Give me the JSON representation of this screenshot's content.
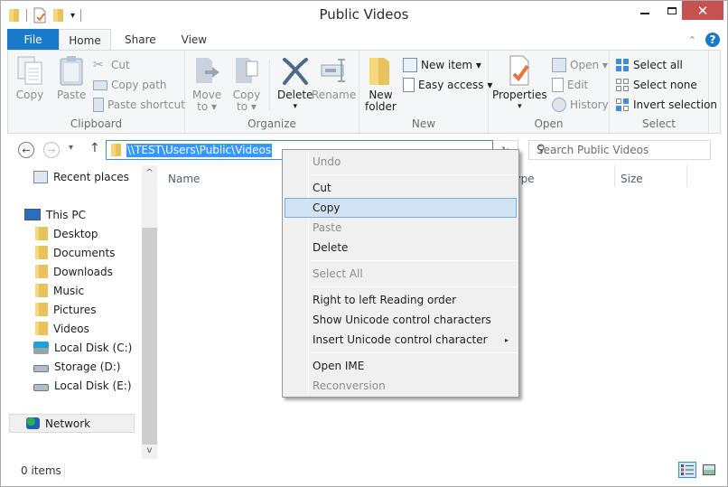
{
  "window": {
    "title": "Public Videos",
    "controls": {
      "minimize": "—",
      "maximize": "☐",
      "close": "✕"
    }
  },
  "quick_access": {
    "dropdown": "▾"
  },
  "ribbon_tabs": [
    {
      "label": "File"
    },
    {
      "label": "Home"
    },
    {
      "label": "Share"
    },
    {
      "label": "View"
    }
  ],
  "ribbon": {
    "clipboard": {
      "label": "Clipboard",
      "copy": "Copy",
      "paste": "Paste",
      "cut": "Cut",
      "copy_path": "Copy path",
      "paste_shortcut": "Paste shortcut"
    },
    "organize": {
      "label": "Organize",
      "move_to": "Move",
      "move_to_2": "to ▾",
      "copy_to": "Copy",
      "copy_to_2": "to ▾",
      "delete": "Delete",
      "delete_arrow": "▾",
      "rename": "Rename"
    },
    "new": {
      "label": "New",
      "new_folder": "New",
      "new_folder_2": "folder",
      "new_item": "New item ▾",
      "easy_access": "Easy access ▾"
    },
    "open": {
      "label": "Open",
      "properties": "Properties",
      "properties_arrow": "▾",
      "open": "Open ▾",
      "edit": "Edit",
      "history": "History"
    },
    "select": {
      "label": "Select",
      "select_all": "Select all",
      "select_none": "Select none",
      "invert_selection": "Invert selection"
    }
  },
  "navigation": {
    "back": "←",
    "forward": "→",
    "recent": "▾",
    "up": "↑",
    "address": "\\\\TEST\\Users\\Public\\Videos",
    "refresh": "↻",
    "search_placeholder": "Search Public Videos",
    "search_icon": "⚲"
  },
  "nav_pane": {
    "items": [
      {
        "label": "Recent places",
        "icon": "recent-places-icon"
      },
      {
        "label": "This PC",
        "icon": "computer-icon"
      },
      {
        "label": "Desktop",
        "icon": "desktop-folder-icon"
      },
      {
        "label": "Documents",
        "icon": "documents-folder-icon"
      },
      {
        "label": "Downloads",
        "icon": "downloads-folder-icon"
      },
      {
        "label": "Music",
        "icon": "music-folder-icon"
      },
      {
        "label": "Pictures",
        "icon": "pictures-folder-icon"
      },
      {
        "label": "Videos",
        "icon": "videos-folder-icon"
      },
      {
        "label": "Local Disk (C:)",
        "icon": "system-drive-icon"
      },
      {
        "label": "Storage (D:)",
        "icon": "drive-icon"
      },
      {
        "label": "Local Disk (E:)",
        "icon": "drive-icon"
      },
      {
        "label": "Network",
        "icon": "network-icon"
      }
    ],
    "scroll_up": "^",
    "scroll_down": "v"
  },
  "columns": [
    "Name",
    "Type",
    "Size"
  ],
  "status": {
    "items": "0 items"
  },
  "context_menu": {
    "items": [
      {
        "label": "Undo",
        "enabled": false
      },
      {
        "label": "Cut",
        "enabled": true
      },
      {
        "label": "Copy",
        "enabled": true,
        "highlighted": true
      },
      {
        "label": "Paste",
        "enabled": false
      },
      {
        "label": "Delete",
        "enabled": true
      },
      {
        "label": "Select All",
        "enabled": false
      },
      {
        "label": "Right to left Reading order",
        "enabled": true
      },
      {
        "label": "Show Unicode control characters",
        "enabled": true
      },
      {
        "label": "Insert Unicode control character",
        "enabled": true,
        "submenu": "▸"
      },
      {
        "label": "Open IME",
        "enabled": true
      },
      {
        "label": "Reconversion",
        "enabled": false
      }
    ]
  },
  "colors": {
    "accent": "#1979ca",
    "close_button": "#c75050",
    "selection": "#3399ff",
    "menu_highlight": "#d1e2f2"
  }
}
